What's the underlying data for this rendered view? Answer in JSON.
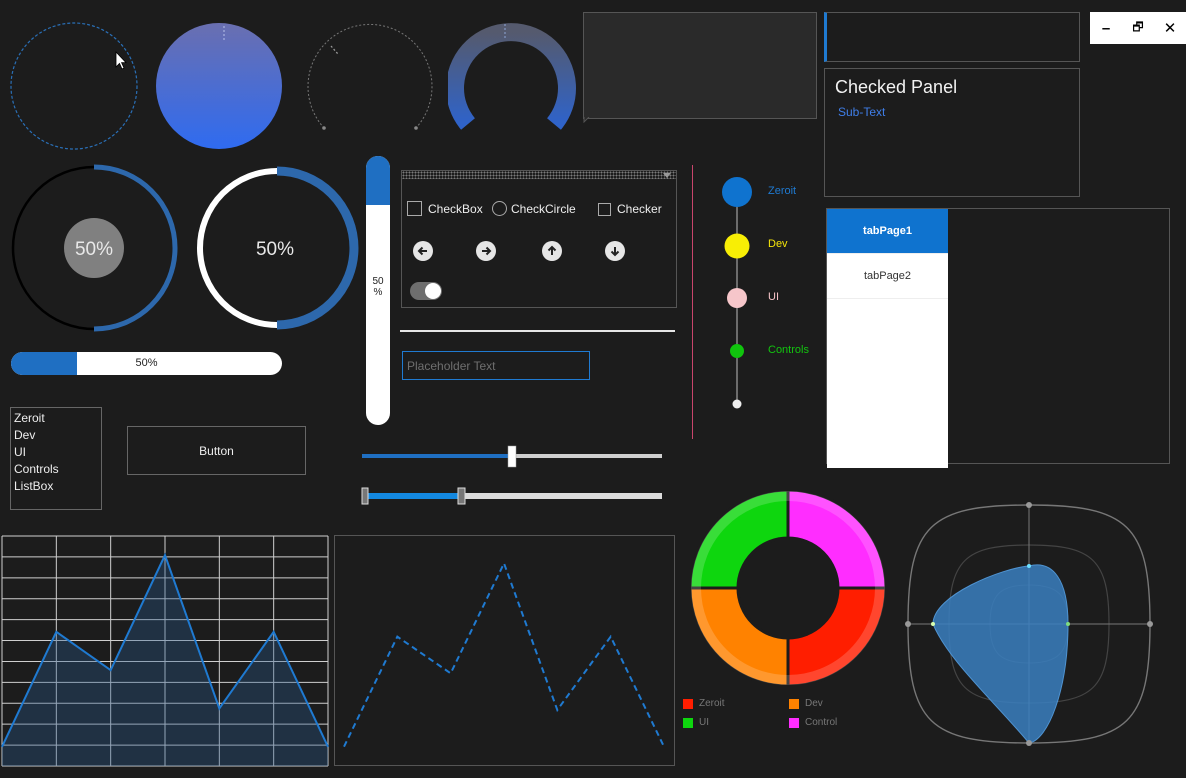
{
  "window_controls": {
    "minimize": "–",
    "restore": "🗗",
    "close": "✕"
  },
  "gauges": {
    "dotted_knob": "",
    "gradient_knob": "",
    "arc_knob": "",
    "semi_arc_knob": ""
  },
  "circular_progress": [
    {
      "label": "50%",
      "value": 50
    },
    {
      "label": "50%",
      "value": 50
    }
  ],
  "horizontal_progress": {
    "label": "50%",
    "value": 50
  },
  "vertical_progress": {
    "label_top": "50",
    "label_bottom": "%",
    "value": 50
  },
  "panels": {
    "checked_panel": {
      "title": "Checked Panel",
      "subtext": "Sub-Text"
    }
  },
  "controls": {
    "checkbox_label": "CheckBox",
    "checkcircle_label": "CheckCircle",
    "checker_label": "Checker",
    "arrows": [
      "arrow-left-icon",
      "arrow-right-icon",
      "arrow-up-icon",
      "arrow-down-icon"
    ],
    "toggle_on": true
  },
  "textbox": {
    "placeholder": "Placeholder Text"
  },
  "listbox": {
    "items": [
      "Zeroit",
      "Dev",
      "UI",
      "Controls",
      "ListBox"
    ]
  },
  "button": {
    "label": "Button"
  },
  "sliders": {
    "single_value": 50,
    "range_start": 0,
    "range_end": 33
  },
  "timeline": {
    "items": [
      {
        "label": "Zeroit",
        "color": "#1f7ad1"
      },
      {
        "label": "Dev",
        "color": "#f5e60a"
      },
      {
        "label": "UI",
        "color": "#f7c4c8"
      },
      {
        "label": "Controls",
        "color": "#12c40f"
      }
    ]
  },
  "tabs": {
    "items": [
      "tabPage1",
      "tabPage2"
    ],
    "active": 0
  },
  "donut": {
    "segments": [
      {
        "name": "Zeroit",
        "color": "#ff1e00",
        "value": 25
      },
      {
        "name": "Dev",
        "color": "#ff8200",
        "value": 25
      },
      {
        "name": "UI",
        "color": "#0ed60e",
        "value": 25
      },
      {
        "name": "Control",
        "color": "#ff2dff",
        "value": 25
      }
    ]
  },
  "chart_data": [
    {
      "type": "area",
      "x": [
        0,
        1,
        2,
        3,
        4,
        5,
        6
      ],
      "values": [
        1,
        7,
        5,
        11,
        3,
        7,
        1
      ],
      "ylim": [
        0,
        12
      ],
      "grid": true
    },
    {
      "type": "line",
      "x": [
        0,
        1,
        2,
        3,
        4,
        5,
        6
      ],
      "values": [
        1,
        7,
        5,
        11,
        3,
        7,
        1
      ],
      "ylim": [
        0,
        12
      ],
      "grid": false
    },
    {
      "type": "pie",
      "categories": [
        "Zeroit",
        "Dev",
        "UI",
        "Control"
      ],
      "values": [
        25,
        25,
        25,
        25
      ]
    }
  ]
}
